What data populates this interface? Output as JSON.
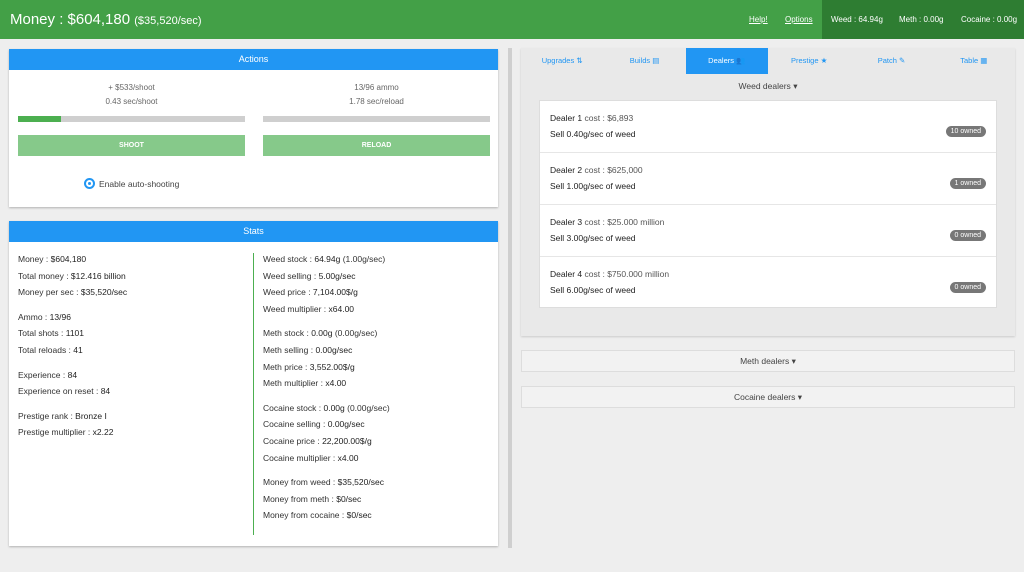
{
  "header": {
    "money_label": "Money : $604,180",
    "money_rate": "($35,520/sec)",
    "help": "Help!",
    "options": "Options",
    "weed": "Weed : 64.94g",
    "meth": "Meth : 0.00g",
    "cocaine": "Cocaine : 0.00g"
  },
  "actions": {
    "title": "Actions",
    "shoot_gain": "+ $533/shoot",
    "shoot_rate": "0.43 sec/shoot",
    "ammo": "13/96 ammo",
    "reload_rate": "1.78 sec/reload",
    "shoot_progress_pct": 19,
    "reload_progress_pct": 0,
    "shoot_label": "SHOOT",
    "reload_label": "RELOAD",
    "autoshoot_label": "Enable auto-shooting"
  },
  "stats": {
    "title": "Stats",
    "left": [
      {
        "k": "Money : ",
        "v": "$604,180"
      },
      {
        "k": "Total money : ",
        "v": "$12.416 billion"
      },
      {
        "k": "Money per sec : ",
        "v": "$35,520/sec"
      },
      {
        "k": "Ammo : ",
        "v": "13/96"
      },
      {
        "k": "Total shots : ",
        "v": "1101"
      },
      {
        "k": "Total reloads : ",
        "v": "41"
      },
      {
        "k": "Experience : ",
        "v": "84"
      },
      {
        "k": "Experience on reset : ",
        "v": "84"
      },
      {
        "k": "Prestige rank : ",
        "v": "Bronze I"
      },
      {
        "k": "Prestige multiplier : ",
        "v": "x2.22"
      }
    ],
    "right": [
      {
        "k": "Weed stock : ",
        "v": "64.94g",
        "extra": " (1.00g/sec)"
      },
      {
        "k": "Weed selling : ",
        "v": "5.00g/sec"
      },
      {
        "k": "Weed price : ",
        "v": "7,104.00$/g"
      },
      {
        "k": "Weed multiplier : ",
        "v": "x64.00"
      },
      {
        "k": "Meth stock : ",
        "v": "0.00g",
        "extra": " (0.00g/sec)"
      },
      {
        "k": "Meth selling : ",
        "v": "0.00g/sec"
      },
      {
        "k": "Meth price : ",
        "v": "3,552.00$/g"
      },
      {
        "k": "Meth multiplier : ",
        "v": "x4.00"
      },
      {
        "k": "Cocaine stock : ",
        "v": "0.00g",
        "extra": " (0.00g/sec)"
      },
      {
        "k": "Cocaine selling : ",
        "v": "0.00g/sec"
      },
      {
        "k": "Cocaine price : ",
        "v": "22,200.00$/g"
      },
      {
        "k": "Cocaine multiplier : ",
        "v": "x4.00"
      },
      {
        "k": "Money from weed : ",
        "v": "$35,520/sec"
      },
      {
        "k": "Money from meth : ",
        "v": "$0/sec"
      },
      {
        "k": "Money from cocaine : ",
        "v": "$0/sec"
      }
    ]
  },
  "tabs": [
    {
      "label": "Upgrades",
      "icon": "sort-icon"
    },
    {
      "label": "Builds",
      "icon": "building-icon"
    },
    {
      "label": "Dealers",
      "icon": "users-icon"
    },
    {
      "label": "Prestige",
      "icon": "star-icon"
    },
    {
      "label": "Patch",
      "icon": "pencil-icon"
    },
    {
      "label": "Table",
      "icon": "table-icon"
    }
  ],
  "dealers": {
    "weed_title": "Weed dealers",
    "meth_title": "Meth dealers",
    "cocaine_title": "Cocaine dealers",
    "list": [
      {
        "name": "Dealer 1",
        "cost": "cost : $6,893",
        "sell_prefix": "Sell 0.40g/sec of ",
        "drug": "weed",
        "owned": "10 owned"
      },
      {
        "name": "Dealer 2",
        "cost": "cost : $625,000",
        "sell_prefix": "Sell 1.00g/sec of ",
        "drug": "weed",
        "owned": "1 owned"
      },
      {
        "name": "Dealer 3",
        "cost": "cost : $25.000 million",
        "sell_prefix": "Sell 3.00g/sec of ",
        "drug": "weed",
        "owned": "0 owned"
      },
      {
        "name": "Dealer 4",
        "cost": "cost : $750.000 million",
        "sell_prefix": "Sell 6.00g/sec of ",
        "drug": "weed",
        "owned": "0 owned"
      }
    ]
  },
  "colors": {
    "topbar": "#43a047",
    "header_blue": "#2196f3",
    "button_green": "#86c98a",
    "badge": "#777777"
  }
}
